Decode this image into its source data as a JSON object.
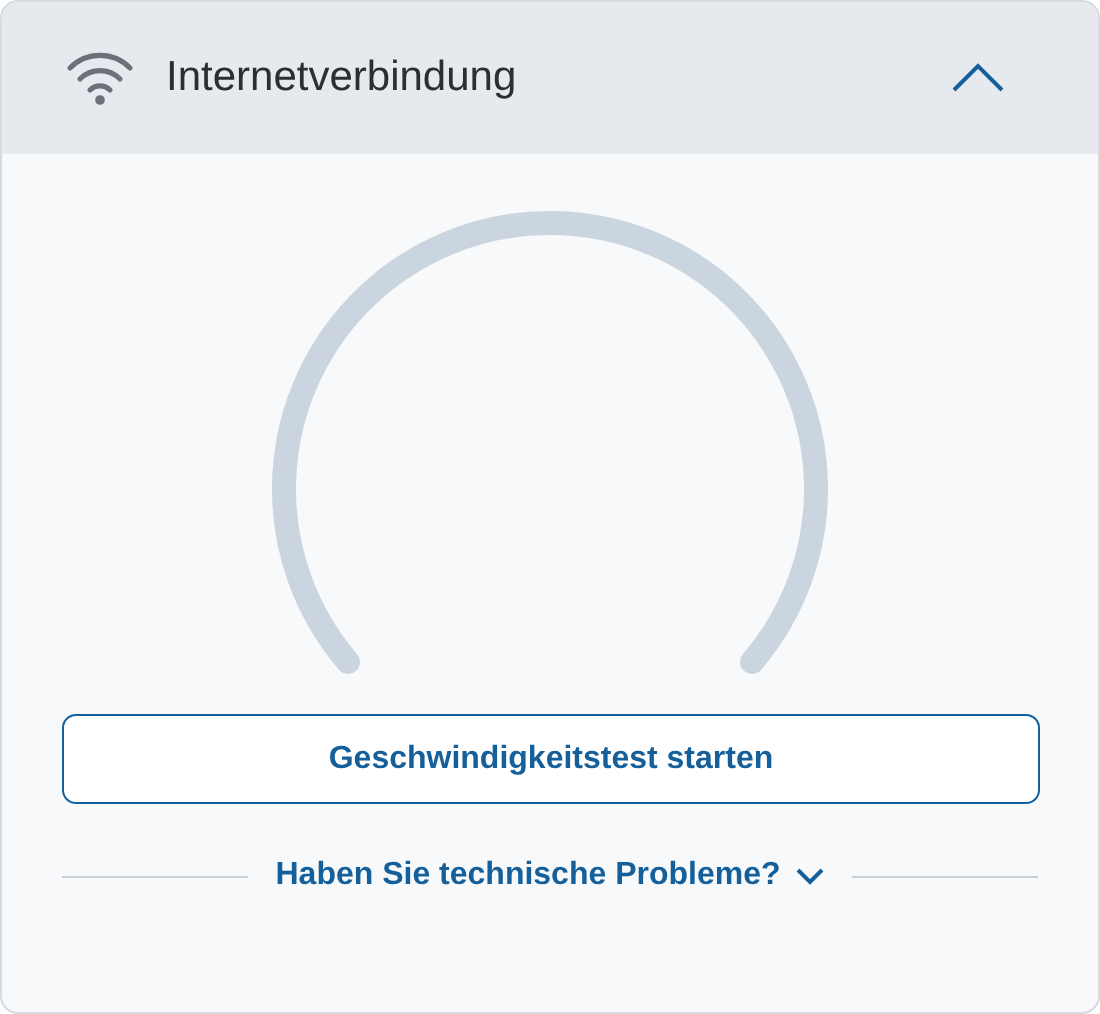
{
  "panel": {
    "title": "Internetverbindung",
    "expanded": true
  },
  "start_button": {
    "label": "Geschwindigkeitstest starten"
  },
  "help_link": {
    "label": "Haben Sie technische Probleme?",
    "expanded": false
  }
}
